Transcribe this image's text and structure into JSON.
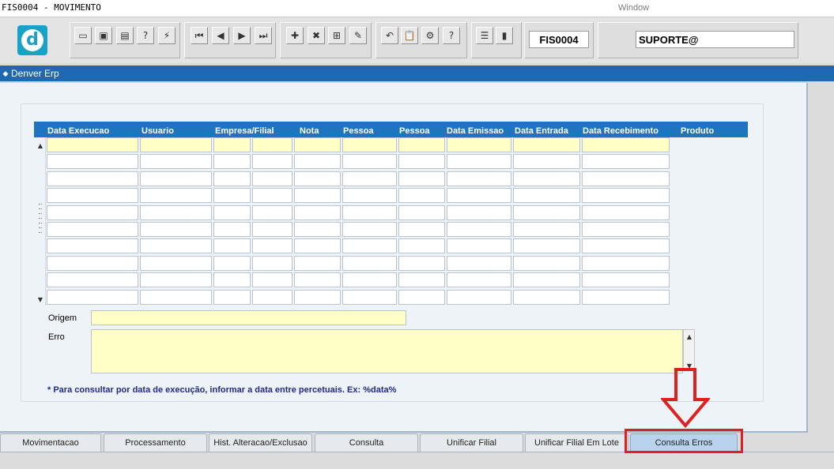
{
  "window": {
    "title": "FIS0004 - MOVIMENTO",
    "menu_label": "Window"
  },
  "toolbar": {
    "logo_letter": "d",
    "form_code": "FIS0004",
    "user": "SUPORTE@",
    "buttons": [
      {
        "name": "save-icon",
        "glyph": "▭"
      },
      {
        "name": "window-icon",
        "glyph": "▣"
      },
      {
        "name": "print-icon",
        "glyph": "▤"
      },
      {
        "name": "help-query-icon",
        "glyph": "?"
      },
      {
        "name": "execute-query-icon",
        "glyph": "⚡"
      },
      {
        "name": "first-record-icon",
        "glyph": "⏮"
      },
      {
        "name": "previous-record-icon",
        "glyph": "◀"
      },
      {
        "name": "next-record-icon",
        "glyph": "▶"
      },
      {
        "name": "last-record-icon",
        "glyph": "⏭"
      },
      {
        "name": "insert-record-icon",
        "glyph": "✚"
      },
      {
        "name": "delete-record-icon",
        "glyph": "✖"
      },
      {
        "name": "list-values-icon",
        "glyph": "⊞"
      },
      {
        "name": "edit-icon",
        "glyph": "✎"
      },
      {
        "name": "undo-icon",
        "glyph": "↶"
      },
      {
        "name": "clipboard-icon",
        "glyph": "📋"
      },
      {
        "name": "settings-icon",
        "glyph": "⚙"
      },
      {
        "name": "help-icon",
        "glyph": "?"
      },
      {
        "name": "menu-icon",
        "glyph": "☰"
      },
      {
        "name": "exit-icon",
        "glyph": "▮"
      }
    ]
  },
  "mdi": {
    "title": "Denver Erp"
  },
  "grid": {
    "columns": [
      "Data Execucao",
      "Usuario",
      "Empresa/Filial",
      "Nota",
      "Pessoa",
      "Pessoa",
      "Data Emissao",
      "Data Entrada",
      "Data Recebimento",
      "Produto"
    ],
    "row_count": 10,
    "selected_row": 0
  },
  "detail": {
    "origem_label": "Origem",
    "origem_value": "",
    "erro_label": "Erro",
    "erro_value": ""
  },
  "hint": "* Para consultar por data de execução, informar a data entre percetuais. Ex: %data%",
  "tabs": [
    {
      "label": "Movimentacao",
      "active": false
    },
    {
      "label": "Processamento",
      "active": false
    },
    {
      "label": "Hist. Alteracao/Exclusao",
      "active": false
    },
    {
      "label": "Consulta",
      "active": false
    },
    {
      "label": "Unificar Filial",
      "active": false
    },
    {
      "label": "Unificar Filial Em Lote",
      "active": false
    },
    {
      "label": "Consulta Erros",
      "active": true
    }
  ],
  "colors": {
    "header_blue": "#1d75c0",
    "selected_row": "#ffffc6",
    "annotation_red": "#e02020"
  }
}
